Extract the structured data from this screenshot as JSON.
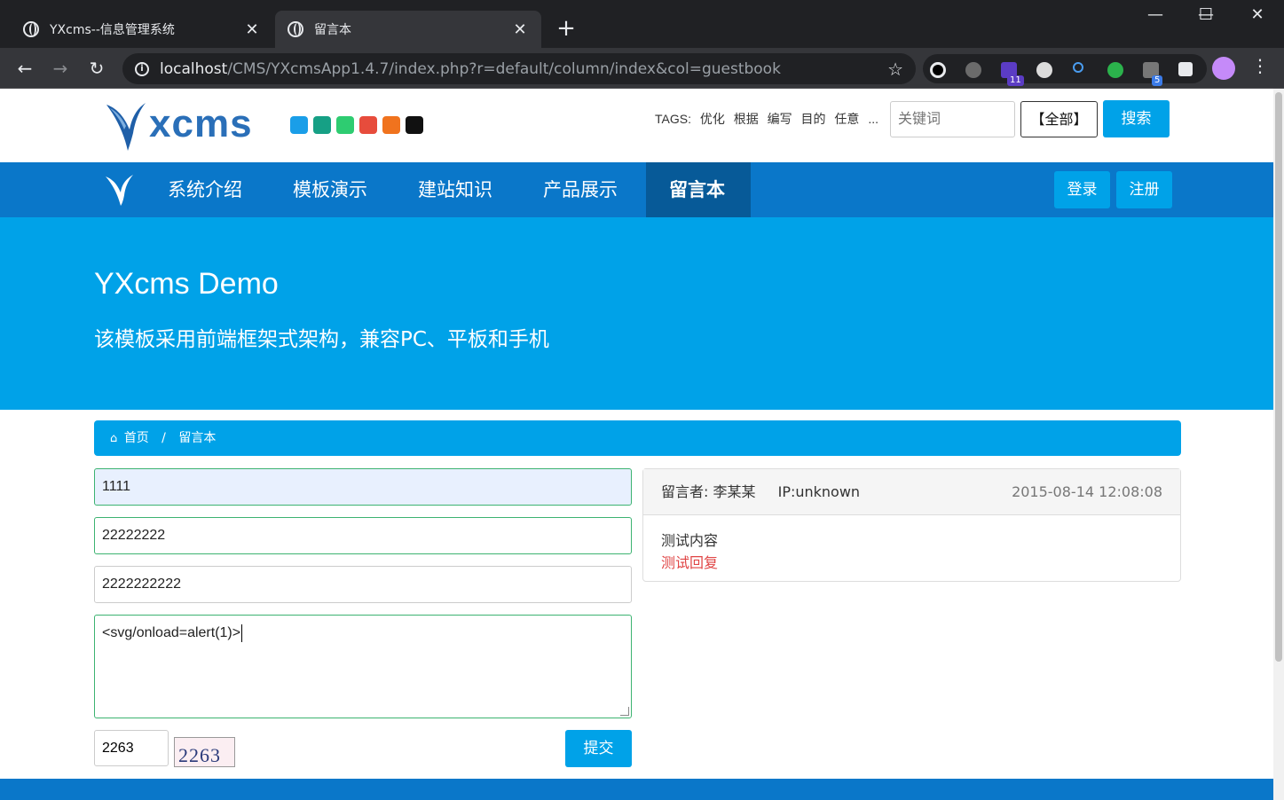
{
  "browser": {
    "tabs": [
      {
        "title": "YXcms--信息管理系统",
        "close": "✕"
      },
      {
        "title": "留言本",
        "close": "✕"
      }
    ],
    "new_tab": "+",
    "window": {
      "minimize": "—",
      "maximize": "☐",
      "close": "✕"
    },
    "nav": {
      "back": "←",
      "forward": "→",
      "reload": "↻",
      "info": "i",
      "star": "☆",
      "menu": "⋮"
    },
    "url_host": "localhost",
    "url_path": "/CMS/YXcmsApp1.4.7/index.php?r=default/column/index&col=guestbook",
    "extension_badges": {
      "graduation": "11",
      "tabs": "5"
    }
  },
  "header": {
    "logo_text": "xcms",
    "swatch_colors": [
      "#1a9ee8",
      "#16a085",
      "#2ecc71",
      "#e74c3c",
      "#f0731e",
      "#111111"
    ],
    "tags_label": "TAGS:",
    "tags": [
      "优化",
      "根据",
      "编写",
      "目的",
      "任意",
      "..."
    ],
    "search_placeholder": "关键词",
    "scope_label": "【全部】",
    "search_label": "搜索"
  },
  "nav": {
    "items": [
      "系统介绍",
      "模板演示",
      "建站知识",
      "产品展示",
      "留言本"
    ],
    "login": "登录",
    "register": "注册"
  },
  "hero": {
    "title": "YXcms Demo",
    "subtitle": "该模板采用前端框架式架构，兼容PC、平板和手机"
  },
  "breadcrumb": {
    "home": "首页",
    "separator": "/",
    "current": "留言本"
  },
  "form": {
    "field1": "1111",
    "field2": "22222222",
    "field3": "2222222222",
    "message": "<svg/onload=alert(1)>",
    "captcha_value": "2263",
    "captcha_image_text": "2263",
    "submit": "提交"
  },
  "guestbook": {
    "author_label": "留言者:",
    "author": "李某某",
    "ip": "IP:unknown",
    "date": "2015-08-14 12:08:08",
    "content": "测试内容",
    "reply": "测试回复"
  },
  "colors": {
    "accent": "#00a2e8",
    "nav": "#0a77c9",
    "nav_active": "#075a98",
    "reply": "#e04444"
  }
}
